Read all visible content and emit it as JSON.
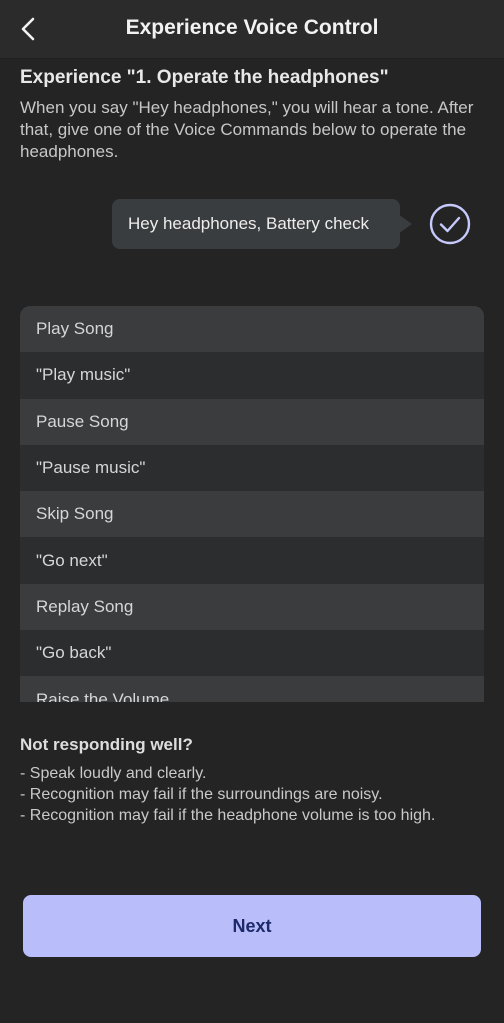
{
  "header": {
    "title": "Experience Voice Control",
    "back_icon": "chevron-left-icon"
  },
  "section": {
    "title": "Experience \"1. Operate the headphones\"",
    "description": "When you say \"Hey headphones,\" you will hear a tone. After that, give one of the Voice Commands below to operate the headphones."
  },
  "bubble": {
    "text": "Hey headphones, Battery check",
    "status_icon": "check-circle-icon",
    "accent_color": "#c6c9fb"
  },
  "commands": [
    {
      "name": "Play Song",
      "phrase": "\"Play music\""
    },
    {
      "name": "Pause Song",
      "phrase": "\"Pause music\""
    },
    {
      "name": "Skip Song",
      "phrase": "\"Go next\""
    },
    {
      "name": "Replay Song",
      "phrase": "\"Go back\""
    },
    {
      "name": "Raise the Volume",
      "phrase": ""
    }
  ],
  "tips": {
    "title": "Not responding well?",
    "items": [
      "- Speak loudly and clearly.",
      "- Recognition may fail if the surroundings are noisy.",
      "- Recognition may fail if the headphone volume is too high."
    ]
  },
  "footer": {
    "next_label": "Next",
    "button_color": "#b9befb"
  }
}
